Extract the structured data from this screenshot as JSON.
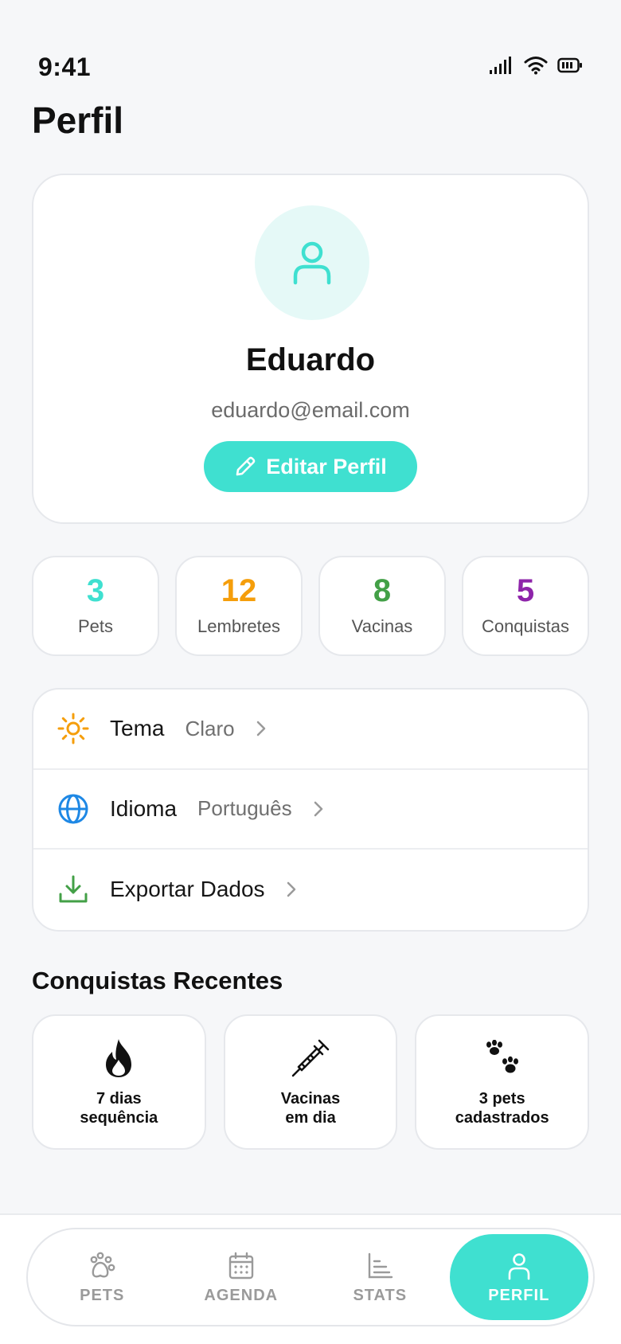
{
  "status_bar": {
    "time": "9:41"
  },
  "page": {
    "title": "Perfil"
  },
  "profile": {
    "name": "Eduardo",
    "email": "eduardo@email.com",
    "edit_label": "Editar Perfil"
  },
  "stats": [
    {
      "value": "3",
      "label": "Pets",
      "color": "#3fe0d0"
    },
    {
      "value": "12",
      "label": "Lembretes",
      "color": "#f59e0b"
    },
    {
      "value": "8",
      "label": "Vacinas",
      "color": "#43a047"
    },
    {
      "value": "5",
      "label": "Conquistas",
      "color": "#8e24aa"
    }
  ],
  "settings": [
    {
      "icon": "sun-icon",
      "label": "Tema",
      "value": "Claro",
      "color": "#f59e0b"
    },
    {
      "icon": "globe-icon",
      "label": "Idioma",
      "value": "Português",
      "color": "#1e88e5"
    },
    {
      "icon": "download-icon",
      "label": "Exportar Dados",
      "value": "",
      "color": "#43a047"
    }
  ],
  "achievements": {
    "title": "Conquistas Recentes",
    "items": [
      {
        "icon": "fire-icon",
        "label": "7 dias\nsequência"
      },
      {
        "icon": "syringe-icon",
        "label": "Vacinas\nem dia"
      },
      {
        "icon": "paw-icon",
        "label": "3 pets\ncadastrados"
      }
    ]
  },
  "tabs": [
    {
      "icon": "paw-outline-icon",
      "label": "PETS",
      "active": false
    },
    {
      "icon": "calendar-icon",
      "label": "AGENDA",
      "active": false
    },
    {
      "icon": "chart-icon",
      "label": "STATS",
      "active": false
    },
    {
      "icon": "user-icon",
      "label": "PERFIL",
      "active": true
    }
  ],
  "colors": {
    "accent": "#3fe0d0",
    "background": "#f6f7f9"
  }
}
